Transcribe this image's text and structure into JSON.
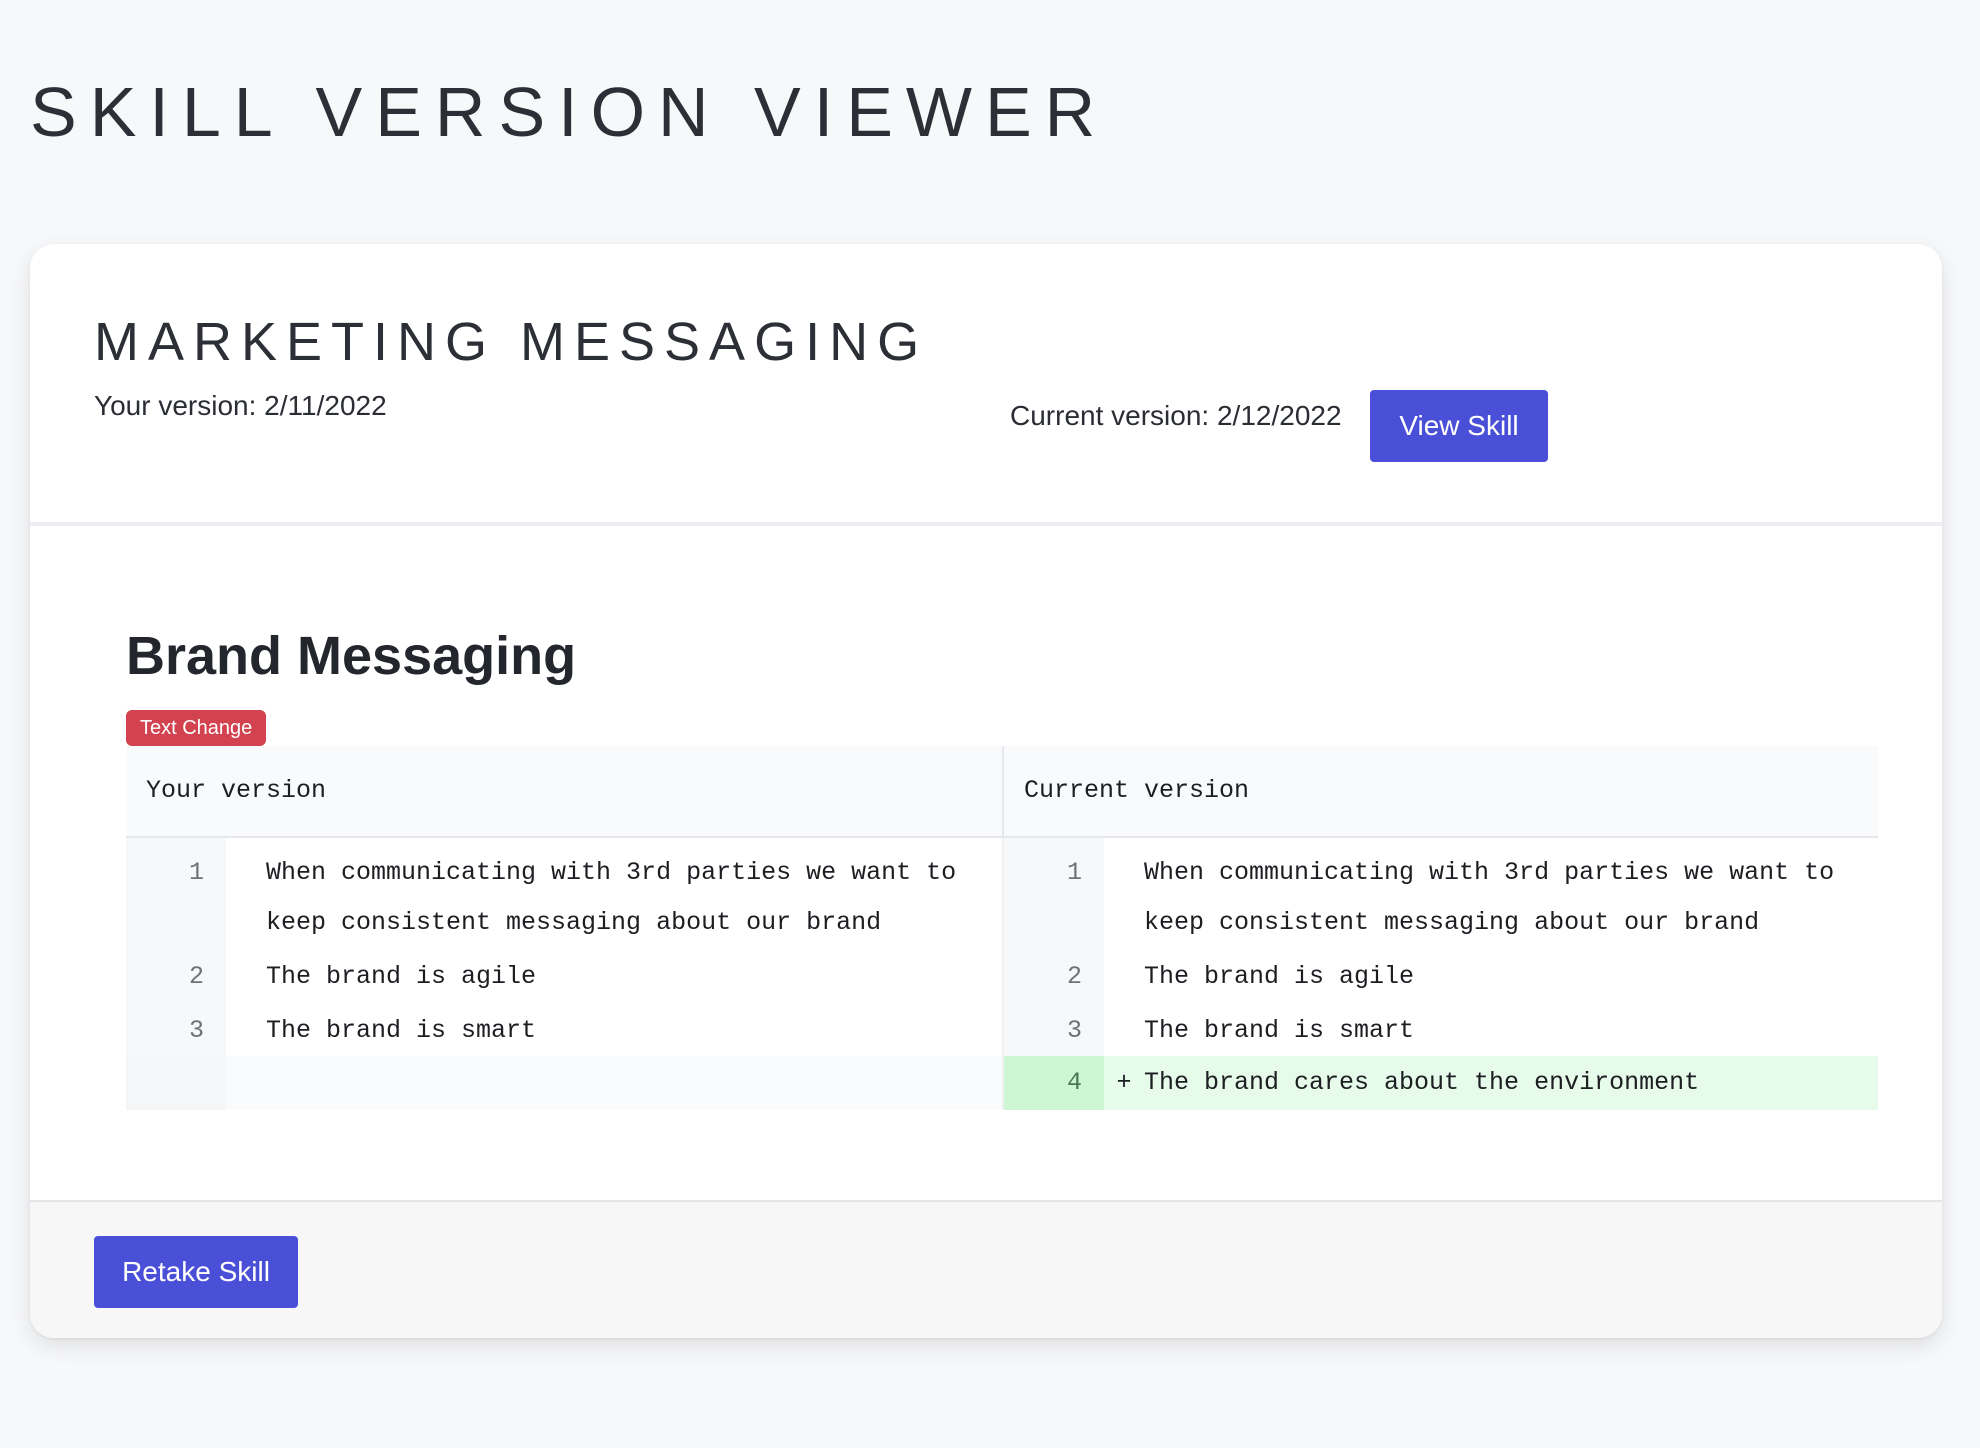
{
  "app": {
    "title": "SKILL VERSION VIEWER"
  },
  "skill": {
    "title": "MARKETING MESSAGING",
    "your_version": "Your version: 2/11/2022",
    "current_version": "Current version: 2/12/2022",
    "view_button": "View Skill"
  },
  "section": {
    "title": "Brand Messaging",
    "badge": "Text Change",
    "badge_color": "#d2434f"
  },
  "diff": {
    "left_header": "Your version",
    "right_header": "Current version",
    "left_lines": [
      {
        "num": "1",
        "text": "When communicating with 3rd parties we want to keep consistent messaging about our brand"
      },
      {
        "num": "2",
        "text": "The brand is agile"
      },
      {
        "num": "3",
        "text": "The brand is smart"
      }
    ],
    "right_lines": [
      {
        "num": "1",
        "text": "When communicating with 3rd parties we want to keep consistent messaging about our brand"
      },
      {
        "num": "2",
        "text": "The brand is agile"
      },
      {
        "num": "3",
        "text": "The brand is smart"
      },
      {
        "num": "4",
        "marker": "+",
        "text": "The brand cares about the environment",
        "status": "added"
      }
    ],
    "added_color": "#e7fbea"
  },
  "footer": {
    "retake_button": "Retake Skill"
  },
  "colors": {
    "accent": "#4a4fd8",
    "background": "#f7f8fa"
  }
}
